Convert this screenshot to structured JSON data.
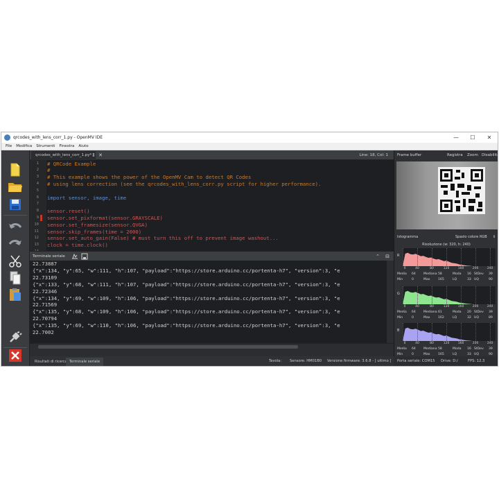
{
  "window": {
    "title": "qrcodes_with_lens_corr_1.py - OpenMV IDE",
    "controls": [
      "—",
      "☐",
      "✕"
    ]
  },
  "menu": [
    "File",
    "Modifica",
    "Strumenti",
    "Finestra",
    "Aiuto"
  ],
  "editor": {
    "tab_label": "qrcodes_with_lens_corr_1.py*",
    "cursor_position": "Line: 18, Col: 1",
    "lines": [
      {
        "n": "1",
        "text": "# QRCode Example",
        "kind": "comment"
      },
      {
        "n": "2",
        "text": "#",
        "kind": "comment"
      },
      {
        "n": "3",
        "text": "# This example shows the power of the OpenMV Cam to detect QR Codes",
        "kind": "comment"
      },
      {
        "n": "4",
        "text": "# using lens correction (see the qrcodes_with_lens_corr.py script for higher performance).",
        "kind": "comment"
      },
      {
        "n": "5",
        "text": "",
        "kind": "plain"
      },
      {
        "n": "6",
        "text": "import sensor, image, time",
        "kind": "kw"
      },
      {
        "n": "7",
        "text": "",
        "kind": "plain"
      },
      {
        "n": "8",
        "text": "sensor.reset()",
        "kind": "call"
      },
      {
        "n": "9",
        "text": "sensor.set_pixformat(sensor.GRAYSCALE)",
        "kind": "call"
      },
      {
        "n": "10",
        "text": "sensor.set_framesize(sensor.QVGA)",
        "kind": "call"
      },
      {
        "n": "11",
        "text": "sensor.skip_frames(time = 2000)",
        "kind": "call"
      },
      {
        "n": "12",
        "text": "sensor.set_auto_gain(False) # must turn this off to prevent image washout...",
        "kind": "call"
      },
      {
        "n": "13",
        "text": "clock = time.clock()",
        "kind": "call"
      },
      {
        "n": "14",
        "text": "",
        "kind": "plain"
      }
    ]
  },
  "terminal": {
    "title": "Terminale seriale",
    "lines": [
      "22.73887",
      "{\"x\":134, \"y\":65, \"w\":111, \"h\":107, \"payload\":\"https://store.arduino.cc/portenta-h7\", \"version\":3, \"e",
      "22.73109",
      "{\"x\":133, \"y\":68, \"w\":111, \"h\":107, \"payload\":\"https://store.arduino.cc/portenta-h7\", \"version\":3, \"e",
      "22.72346",
      "{\"x\":134, \"y\":69, \"w\":109, \"h\":106, \"payload\":\"https://store.arduino.cc/portenta-h7\", \"version\":3, \"e",
      "22.71569",
      "{\"x\":135, \"y\":68, \"w\":109, \"h\":106, \"payload\":\"https://store.arduino.cc/portenta-h7\", \"version\":3, \"e",
      "22.70794",
      "{\"x\":135, \"y\":69, \"w\":110, \"h\":106, \"payload\":\"https://store.arduino.cc/portenta-h7\", \"version\":3, \"e",
      "22.7002"
    ]
  },
  "bottom_tabs": [
    "Risultati di ricerca",
    "Terminale seriale"
  ],
  "status": {
    "tavola": "Tavola:",
    "sensore": "Sensore: HM01B0",
    "firmware": "Versione firmware: 3.6.8 - [ ultimo ]",
    "porta": "Porta seriale: COM15",
    "drive": "Drive: D:/",
    "fps": "FPS: 12.3"
  },
  "framebuffer": {
    "title": "Frame buffer",
    "record": "Registra",
    "zoom": "Zoom",
    "disable": "Disabilita"
  },
  "histogram": {
    "label": "Istogramma",
    "color_space": "Spazio colore RGB",
    "resolution": "Risoluzione (w: 320, h: 240)",
    "tick_labels": [
      "0",
      "40",
      "80",
      "120",
      "160",
      "200",
      "240"
    ],
    "channels": [
      {
        "axis": "R",
        "color": "#f59a9a",
        "media": "64",
        "mediana": "58",
        "moda": "16",
        "stdev": "39",
        "min": "0",
        "max": "165",
        "lq": "33",
        "uq": "90"
      },
      {
        "axis": "G",
        "color": "#8fe58f",
        "media": "64",
        "mediana": "61",
        "moda": "20",
        "stdev": "39",
        "min": "0",
        "max": "162",
        "lq": "32",
        "uq": "89"
      },
      {
        "axis": "B",
        "color": "#a9a3f2",
        "media": "64",
        "mediana": "58",
        "moda": "16",
        "stdev": "39",
        "min": "0",
        "max": "165",
        "lq": "33",
        "uq": "90"
      }
    ],
    "stat_labels": {
      "media": "Media",
      "mediana": "Mediana",
      "moda": "Moda",
      "stdev": "StDev",
      "min": "Min",
      "max": "Max",
      "lq": "LQ",
      "uq": "UQ"
    }
  }
}
